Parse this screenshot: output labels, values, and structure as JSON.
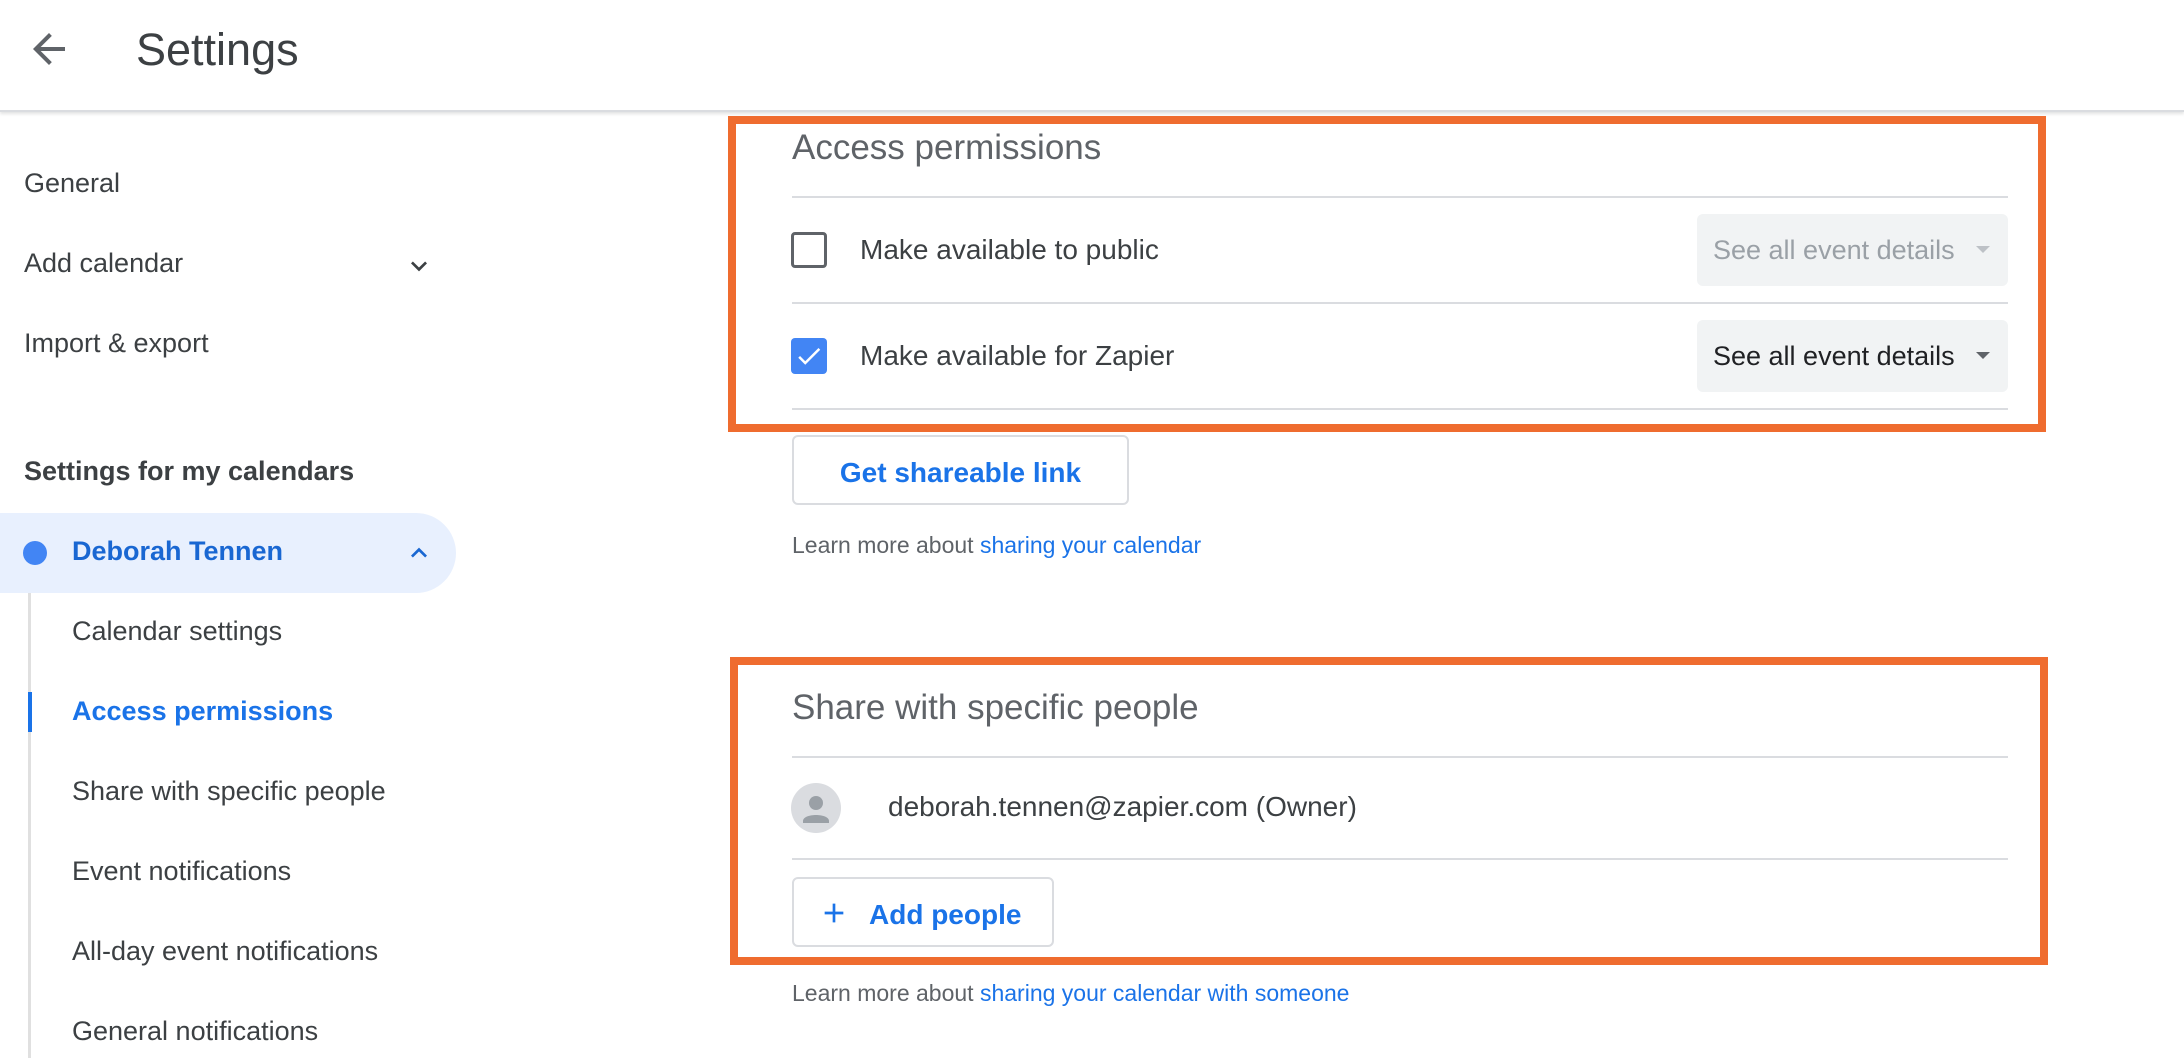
{
  "header": {
    "title": "Settings",
    "back_icon": "arrow-left-icon"
  },
  "sidebar": {
    "items": [
      {
        "label": "General"
      },
      {
        "label": "Add calendar",
        "icon": "chevron-down-icon"
      },
      {
        "label": "Import & export"
      }
    ],
    "section_title": "Settings for my calendars",
    "calendar": {
      "name": "Deborah Tennen",
      "color": "#4285f4",
      "icon": "chevron-up-icon",
      "subitems": [
        {
          "label": "Calendar settings"
        },
        {
          "label": "Access permissions",
          "active": true
        },
        {
          "label": "Share with specific people"
        },
        {
          "label": "Event notifications"
        },
        {
          "label": "All-day event notifications"
        },
        {
          "label": "General notifications"
        }
      ]
    }
  },
  "access_permissions": {
    "title": "Access permissions",
    "rows": [
      {
        "label": "Make available to public",
        "checked": false,
        "select": "See all event details",
        "select_enabled": false
      },
      {
        "label": "Make available for Zapier",
        "checked": true,
        "select": "See all event details",
        "select_enabled": true
      }
    ],
    "share_link_button": "Get shareable link",
    "learn_prefix": "Learn more about",
    "learn_link": "sharing your calendar"
  },
  "share_people": {
    "title": "Share with specific people",
    "owner": "deborah.tennen@zapier.com (Owner)",
    "avatar_icon": "person-icon",
    "add_button": "Add people",
    "add_icon": "plus-icon",
    "learn_prefix": "Learn more about",
    "learn_link": "sharing your calendar with someone"
  },
  "colors": {
    "accent": "#1a73e8",
    "highlight": "#ef6c2f",
    "checkbox_checked": "#4285f4"
  }
}
